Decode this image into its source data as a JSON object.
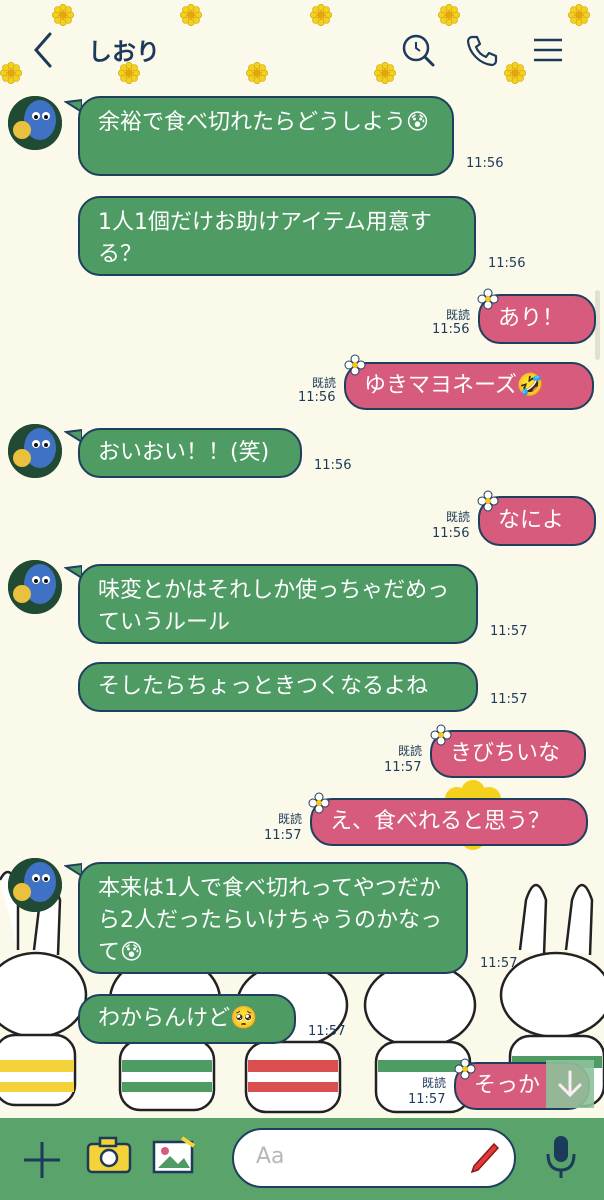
{
  "header": {
    "title": "しおり",
    "back_icon": "chevron-left-icon",
    "icons": [
      "search-icon",
      "phone-icon",
      "menu-icon"
    ]
  },
  "messages": [
    {
      "side": "left",
      "text": "余裕で食べ切れたらどうしよう😰",
      "time": "11:56"
    },
    {
      "side": "left",
      "text": "1人1個だけお助けアイテム用意する？",
      "time": "11:56"
    },
    {
      "side": "right",
      "text": "あり！",
      "time": "11:56",
      "read": "既読"
    },
    {
      "side": "right",
      "text": "ゆきマヨネーズ🤣",
      "time": "11:56",
      "read": "既読"
    },
    {
      "side": "left",
      "text": "おいおい！！(笑)",
      "time": "11:56"
    },
    {
      "side": "right",
      "text": "なによ",
      "time": "11:56",
      "read": "既読"
    },
    {
      "side": "left",
      "text": "味変とかはそれしか使っちゃだめっていうルール",
      "time": "11:57"
    },
    {
      "side": "left",
      "text": "そしたらちょっときつくなるよね",
      "time": "11:57"
    },
    {
      "side": "right",
      "text": "きびちいな",
      "time": "11:57",
      "read": "既読"
    },
    {
      "side": "right",
      "text": "え、食べれると思う？",
      "time": "11:57",
      "read": "既読"
    },
    {
      "side": "left",
      "text": "本来は1人で食べ切れってやつだから2人だったらいけちゃうのかなって😰",
      "time": "11:57"
    },
    {
      "side": "left",
      "text": "わからんけど🥺",
      "time": "11:57"
    },
    {
      "side": "right",
      "text": "そっか",
      "time": "11:57",
      "read": "既読"
    }
  ],
  "input": {
    "placeholder": "Aa",
    "icons": [
      "plus-icon",
      "camera-icon",
      "image-icon",
      "pen-icon",
      "microphone-icon"
    ]
  },
  "scroll_icon": "arrow-down-icon",
  "colors": {
    "background": "#fbf9ea",
    "green_bubble": "#4f9b64",
    "pink_bubble": "#d65b7c",
    "bottom_bar": "#5aa36a",
    "outline": "#1f3f5d"
  }
}
